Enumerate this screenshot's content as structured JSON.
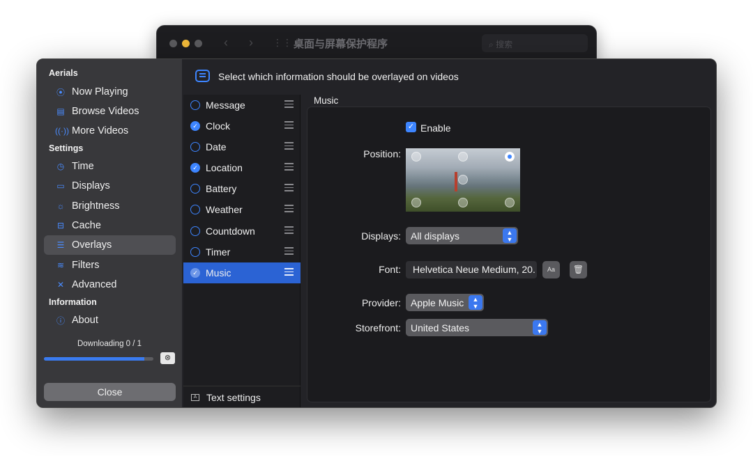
{
  "background_window": {
    "title": "桌面与屏幕保护程序",
    "search_placeholder": "搜索"
  },
  "sidebar": {
    "sections": [
      {
        "title": "Aerials",
        "items": [
          {
            "label": "Now Playing",
            "icon": "play-circle-icon"
          },
          {
            "label": "Browse Videos",
            "icon": "film-icon"
          },
          {
            "label": "More Videos",
            "icon": "antenna-icon"
          }
        ]
      },
      {
        "title": "Settings",
        "items": [
          {
            "label": "Time",
            "icon": "clock-icon"
          },
          {
            "label": "Displays",
            "icon": "display-icon"
          },
          {
            "label": "Brightness",
            "icon": "sun-icon"
          },
          {
            "label": "Cache",
            "icon": "drive-icon"
          },
          {
            "label": "Overlays",
            "icon": "message-icon",
            "active": true
          },
          {
            "label": "Filters",
            "icon": "sliders-icon"
          },
          {
            "label": "Advanced",
            "icon": "tools-icon"
          }
        ]
      },
      {
        "title": "Information",
        "items": [
          {
            "label": "About",
            "icon": "info-icon"
          }
        ]
      }
    ],
    "download_status": "Downloading 0 / 1",
    "download_progress": 0.92,
    "close_label": "Close"
  },
  "header": {
    "message": "Select which information should be overlayed on videos"
  },
  "overlay_list": {
    "items": [
      {
        "label": "Message",
        "enabled": false
      },
      {
        "label": "Clock",
        "enabled": true
      },
      {
        "label": "Date",
        "enabled": false
      },
      {
        "label": "Location",
        "enabled": true
      },
      {
        "label": "Battery",
        "enabled": false
      },
      {
        "label": "Weather",
        "enabled": false
      },
      {
        "label": "Countdown",
        "enabled": false
      },
      {
        "label": "Timer",
        "enabled": false
      },
      {
        "label": "Music",
        "enabled": true,
        "selected": true
      }
    ],
    "footer_label": "Text settings"
  },
  "detail": {
    "title": "Music",
    "enable_label": "Enable",
    "enable_checked": true,
    "position_label": "Position:",
    "selected_position": "top-right",
    "displays_label": "Displays:",
    "displays_value": "All displays",
    "font_label": "Font:",
    "font_value": "Helvetica Neue Medium, 20.",
    "font_button": "Aa",
    "provider_label": "Provider:",
    "provider_value": "Apple Music",
    "storefront_label": "Storefront:",
    "storefront_value": "United States"
  },
  "colors": {
    "accent": "#3d85ff",
    "selection": "#2b63d4"
  }
}
